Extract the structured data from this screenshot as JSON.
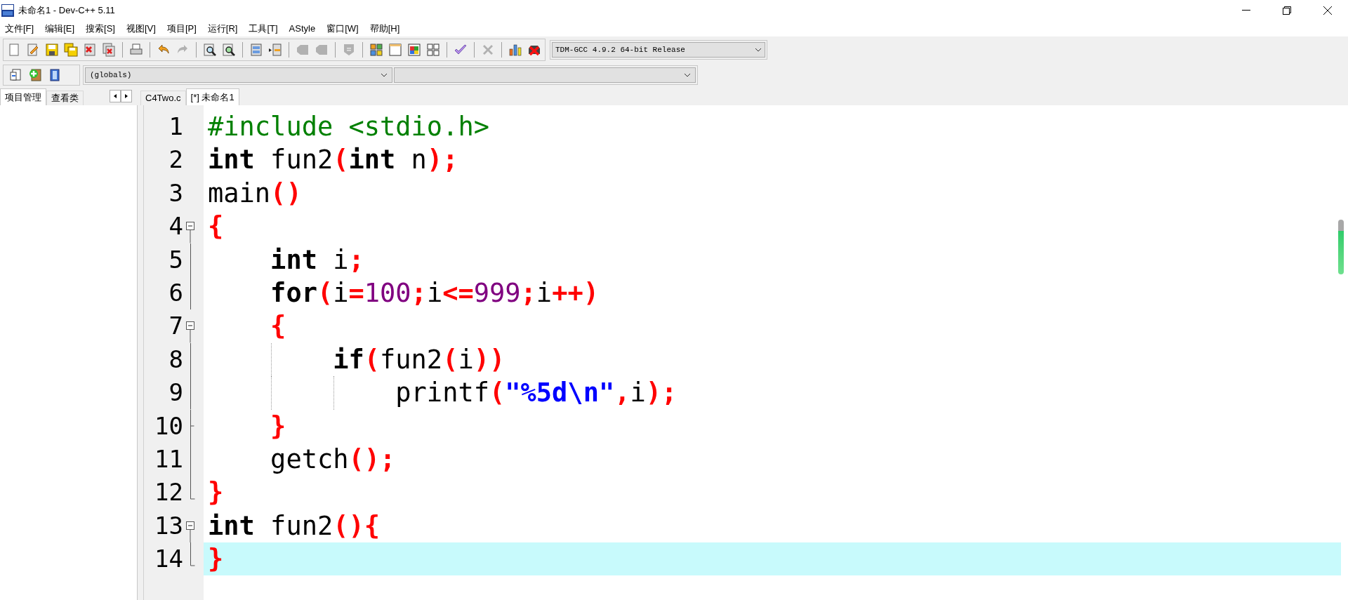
{
  "window": {
    "title": "未命名1 - Dev-C++ 5.11"
  },
  "menu": [
    "文件[F]",
    "编辑[E]",
    "搜索[S]",
    "视图[V]",
    "项目[P]",
    "运行[R]",
    "工具[T]",
    "AStyle",
    "窗口[W]",
    "帮助[H]"
  ],
  "toolbar": [
    {
      "kind": "new",
      "disabled": false
    },
    {
      "kind": "open",
      "disabled": false
    },
    {
      "kind": "save",
      "disabled": false
    },
    {
      "kind": "saveall",
      "disabled": false
    },
    {
      "kind": "close",
      "disabled": false
    },
    {
      "kind": "closeall",
      "disabled": false
    },
    {
      "kind": "separator"
    },
    {
      "kind": "print",
      "disabled": false
    },
    {
      "kind": "separator"
    },
    {
      "kind": "undo",
      "disabled": false
    },
    {
      "kind": "redo",
      "disabled": true
    },
    {
      "kind": "separator"
    },
    {
      "kind": "find",
      "disabled": false
    },
    {
      "kind": "replace",
      "disabled": false
    },
    {
      "kind": "separator"
    },
    {
      "kind": "panel",
      "disabled": false
    },
    {
      "kind": "panelarrow",
      "disabled": false
    },
    {
      "kind": "separator"
    },
    {
      "kind": "tag",
      "disabled": true
    },
    {
      "kind": "tag",
      "disabled": true
    },
    {
      "kind": "separator"
    },
    {
      "kind": "shield",
      "disabled": true
    },
    {
      "kind": "separator"
    },
    {
      "kind": "colorgrid",
      "disabled": false
    },
    {
      "kind": "window",
      "disabled": false
    },
    {
      "kind": "colorwindow",
      "disabled": false
    },
    {
      "kind": "grid",
      "disabled": false
    },
    {
      "kind": "separator"
    },
    {
      "kind": "check",
      "disabled": false
    },
    {
      "kind": "separator"
    },
    {
      "kind": "cross",
      "disabled": true
    },
    {
      "kind": "separator"
    },
    {
      "kind": "chart",
      "disabled": false
    },
    {
      "kind": "crossbadge",
      "disabled": false
    }
  ],
  "compiler": {
    "value": "TDM-GCC 4.9.2 64-bit Release"
  },
  "toolbar2": [
    {
      "kind": "pagearrow",
      "disabled": false
    },
    {
      "kind": "addpage",
      "disabled": false
    },
    {
      "kind": "bookmark",
      "disabled": false
    }
  ],
  "scope_box": {
    "value": "(globals)"
  },
  "side_tabs": [
    {
      "label": "项目管理",
      "selected": true
    },
    {
      "label": "查看类",
      "selected": false
    }
  ],
  "editor_tabs": [
    {
      "label": "C4Two.c",
      "selected": false
    },
    {
      "label": "[*] 未命名1",
      "selected": true
    }
  ],
  "code": [
    {
      "number": "1",
      "kind": "plain",
      "current": false,
      "tokens": [
        {
          "kind": "pre",
          "text": "#include <stdio.h>"
        }
      ]
    },
    {
      "number": "2",
      "kind": "plain",
      "current": false,
      "tokens": [
        {
          "kind": "kw",
          "text": "int"
        },
        {
          "kind": "id",
          "text": " fun2"
        },
        {
          "kind": "sym",
          "text": "("
        },
        {
          "kind": "kw",
          "text": "int"
        },
        {
          "kind": "id",
          "text": " n"
        },
        {
          "kind": "sym",
          "text": ");"
        }
      ]
    },
    {
      "number": "3",
      "kind": "plain",
      "current": false,
      "tokens": [
        {
          "kind": "id",
          "text": "main"
        },
        {
          "kind": "sym",
          "text": "()"
        }
      ]
    },
    {
      "number": "4",
      "kind": "start",
      "current": false,
      "tokens": [
        {
          "kind": "sym",
          "text": "{"
        }
      ]
    },
    {
      "number": "5",
      "kind": "line",
      "current": false,
      "tokens": [
        {
          "kind": "kw",
          "text": "    int"
        },
        {
          "kind": "id",
          "text": " i"
        },
        {
          "kind": "sym",
          "text": ";"
        }
      ]
    },
    {
      "number": "6",
      "kind": "line",
      "current": false,
      "tokens": [
        {
          "kind": "kw",
          "text": "    for"
        },
        {
          "kind": "sym",
          "text": "("
        },
        {
          "kind": "id",
          "text": "i"
        },
        {
          "kind": "sym",
          "text": "="
        },
        {
          "kind": "num",
          "text": "100"
        },
        {
          "kind": "sym",
          "text": ";"
        },
        {
          "kind": "id",
          "text": "i"
        },
        {
          "kind": "sym",
          "text": "<="
        },
        {
          "kind": "num",
          "text": "999"
        },
        {
          "kind": "sym",
          "text": ";"
        },
        {
          "kind": "id",
          "text": "i"
        },
        {
          "kind": "sym",
          "text": "++)"
        }
      ]
    },
    {
      "number": "7",
      "kind": "start",
      "current": false,
      "tokens": [
        {
          "kind": "sym",
          "text": "    {"
        }
      ]
    },
    {
      "number": "8",
      "kind": "line",
      "current": false,
      "tokens": [
        {
          "kind": "kw",
          "text": "        if"
        },
        {
          "kind": "sym",
          "text": "("
        },
        {
          "kind": "id",
          "text": "fun2"
        },
        {
          "kind": "sym",
          "text": "("
        },
        {
          "kind": "id",
          "text": "i"
        },
        {
          "kind": "sym",
          "text": "))"
        }
      ]
    },
    {
      "number": "9",
      "kind": "line",
      "current": false,
      "tokens": [
        {
          "kind": "id",
          "text": "            printf"
        },
        {
          "kind": "sym",
          "text": "("
        },
        {
          "kind": "str",
          "text": "\"%5d\\n\""
        },
        {
          "kind": "sym",
          "text": ","
        },
        {
          "kind": "id",
          "text": "i"
        },
        {
          "kind": "sym",
          "text": ");"
        }
      ]
    },
    {
      "number": "10",
      "kind": "branch",
      "current": false,
      "tokens": [
        {
          "kind": "sym",
          "text": "    }"
        }
      ]
    },
    {
      "number": "11",
      "kind": "line",
      "current": false,
      "tokens": [
        {
          "kind": "id",
          "text": "    getch"
        },
        {
          "kind": "sym",
          "text": "();"
        }
      ]
    },
    {
      "number": "12",
      "kind": "end",
      "current": false,
      "tokens": [
        {
          "kind": "sym",
          "text": "}"
        }
      ]
    },
    {
      "number": "13",
      "kind": "start",
      "current": false,
      "tokens": [
        {
          "kind": "kw",
          "text": "int"
        },
        {
          "kind": "id",
          "text": " fun2"
        },
        {
          "kind": "sym",
          "text": "(){"
        }
      ]
    },
    {
      "number": "14",
      "kind": "end",
      "current": true,
      "tokens": [
        {
          "kind": "sym",
          "text": "}"
        }
      ]
    }
  ]
}
